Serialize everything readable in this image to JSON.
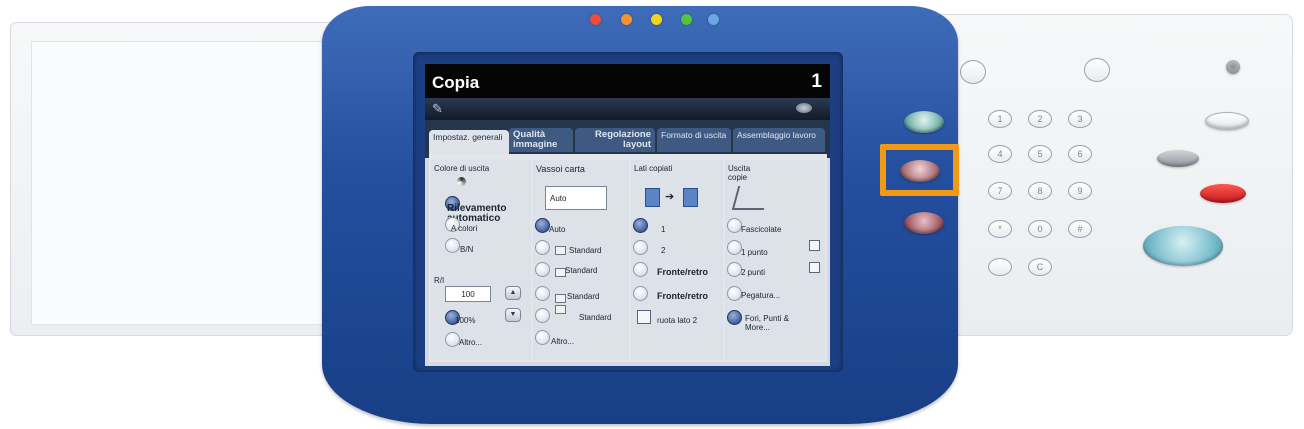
{
  "screen": {
    "title": "Copia",
    "counter": "1",
    "tabs": [
      {
        "label": "Impostaz. generali"
      },
      {
        "label": "Qualità immagine"
      },
      {
        "label": "Regolazione layout"
      },
      {
        "label": "Formato di uscita"
      },
      {
        "label": "Assemblaggio lavoro"
      }
    ],
    "output_color": {
      "heading": "Colore di uscita",
      "options": [
        "Rilevamento automatico",
        "A colori",
        "B/N"
      ],
      "selected": "Rilevamento automatico"
    },
    "reduce_enlarge": {
      "heading": "R/I",
      "value": "100",
      "options": [
        "100%",
        "Altro..."
      ],
      "selected": "100%"
    },
    "paper_trays": {
      "heading": "Vassoi carta",
      "field_value": "Auto",
      "options": [
        "Auto",
        "Standard",
        "Standard",
        "Standard",
        "Standard",
        "Altro..."
      ],
      "selected": "Auto"
    },
    "sides": {
      "heading": "Lati copiati",
      "options": [
        "1",
        "2",
        "Fronte/retro",
        "Fronte/retro"
      ],
      "selected": "1",
      "rotate_label": "ruota lato 2"
    },
    "output": {
      "heading": "Uscita copie",
      "options": [
        "Fascicolate",
        "1 punto",
        "2 punti",
        "Pegatura...",
        "Fori, Punti & More..."
      ],
      "selected": "Fori, Punti & More..."
    }
  },
  "device": {
    "leds": [
      "#ef4a3c",
      "#f59331",
      "#f2d31e",
      "#55c33e",
      "#6ca7e5"
    ],
    "highlight_color": "#f29a16",
    "keypad": [
      "1",
      "2",
      "3",
      "4",
      "5",
      "6",
      "7",
      "8",
      "9",
      "*",
      "0",
      "#",
      "C"
    ]
  }
}
